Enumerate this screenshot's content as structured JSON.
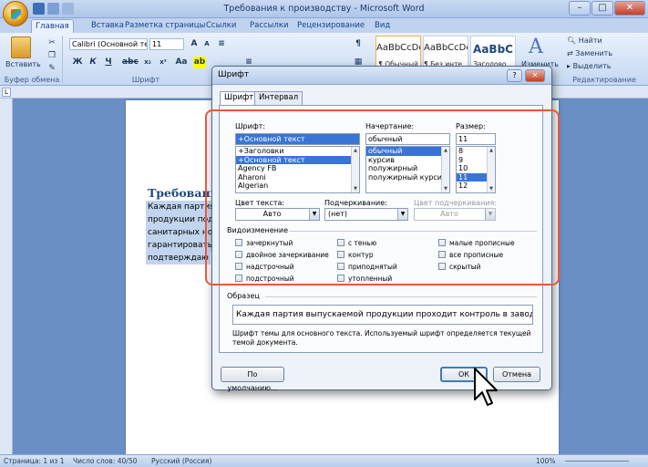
{
  "window": {
    "title": "Требования к производству - Microsoft Word"
  },
  "ribbon_tabs": [
    "Главная",
    "Вставка",
    "Разметка страницы",
    "Ссылки",
    "Рассылки",
    "Рецензирование",
    "Вид"
  ],
  "ribbon": {
    "paste_label": "Вставить",
    "clipboard_group": "Буфер обмена",
    "font_group": "Шрифт",
    "font_name": "Calibri (Основной те",
    "font_size": "11",
    "styles": [
      {
        "preview": "AaBbCcDc",
        "name": "¶ Обычный"
      },
      {
        "preview": "AaBbCcDc",
        "name": "¶ Без инте..."
      },
      {
        "preview": "AaBbC",
        "name": "Заголово..."
      }
    ],
    "change_styles": "Изменить",
    "editing_group": "Редактирование",
    "find_label": "Найти",
    "replace_label": "Заменить",
    "select_label": "Выделить",
    "format_buttons": [
      "Ж",
      "К",
      "Ч"
    ]
  },
  "document": {
    "heading": "Требовани",
    "lines": [
      "Каждая партия в",
      "продукции подв",
      "санитарных нор",
      "гарантировать",
      "подтверждаю"
    ]
  },
  "status_bar": {
    "page": "Страница: 1 из 1",
    "words": "Число слов: 40/50",
    "language": "Русский (Россия)",
    "zoom": "100%"
  },
  "dialog": {
    "title": "Шрифт",
    "help": "?",
    "tabs": [
      "Шрифт",
      "Интервал"
    ],
    "font_label": "Шрифт:",
    "font_value": "+Основной текст",
    "font_list": [
      "+Заголовки",
      "+Основной текст",
      "Agency FB",
      "Aharoni",
      "Algerian"
    ],
    "font_selected_index": 1,
    "style_label": "Начертание:",
    "style_value": "обычный",
    "style_list": [
      "обычный",
      "курсив",
      "полужирный",
      "полужирный курсив"
    ],
    "style_selected_index": 0,
    "size_label": "Размер:",
    "size_value": "11",
    "size_list": [
      "8",
      "9",
      "10",
      "11",
      "12"
    ],
    "size_selected_index": 3,
    "color_label": "Цвет текста:",
    "color_value": "Авто",
    "underline_label": "Подчеркивание:",
    "underline_value": "(нет)",
    "underline_color_label": "Цвет подчеркивания:",
    "underline_color_value": "Авто",
    "effects_label": "Видоизменение",
    "effects": [
      [
        "зачеркнутый",
        "двойное зачеркивание",
        "надстрочный",
        "подстрочный"
      ],
      [
        "с тенью",
        "контур",
        "приподнятый",
        "утопленный"
      ],
      [
        "малые прописные",
        "все прописные",
        "скрытый"
      ]
    ],
    "sample_label": "Образец",
    "sample_text": "Каждая партия выпускаемой продукции проходит контроль в заводской ла",
    "sample_note": "Шрифт темы для основного текста. Используемый шрифт определяется текущей темой документа.",
    "default_button": "По умолчанию...",
    "ok_button": "ОК",
    "cancel_button": "Отмена"
  }
}
